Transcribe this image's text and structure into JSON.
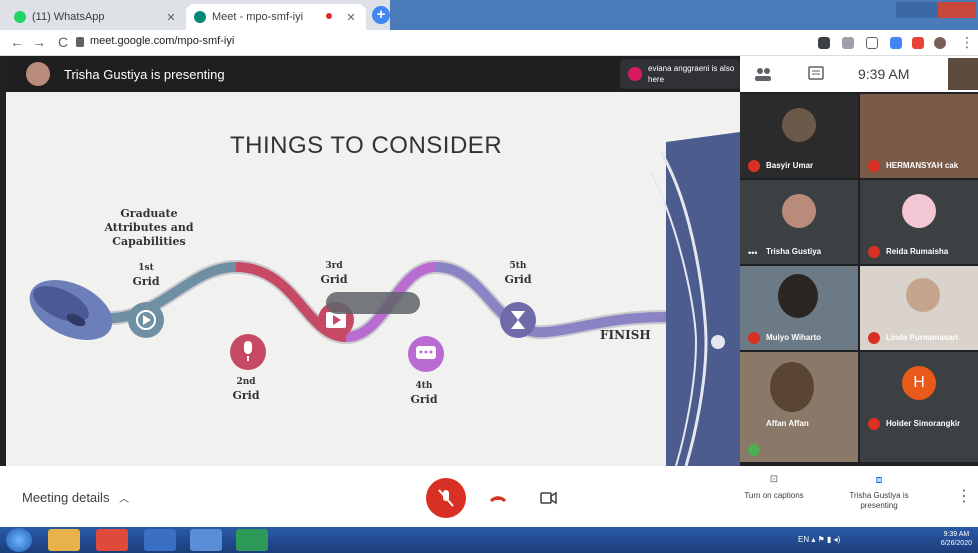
{
  "browser": {
    "tabs": [
      {
        "title": "(11) WhatsApp",
        "color": "#25d366"
      },
      {
        "title": "Meet - mpo-smf-iyi",
        "color": "#00897b"
      }
    ],
    "new_tab": "+",
    "url": "meet.google.com/mpo-smf-iyi",
    "back": "←",
    "forward": "→",
    "reload": "C"
  },
  "meet": {
    "presenter_text": "Trisha Gustiya is presenting",
    "also_here": "eviana anggraeni is also here",
    "clock": "9:39 AM",
    "slide": {
      "title": "THINGS TO CONSIDER",
      "graduate_label": [
        "Graduate",
        "Attributes and",
        "Capabilities"
      ],
      "grid_1": [
        "1st",
        "Grid"
      ],
      "grid_2": [
        "2nd",
        "Grid"
      ],
      "grid_3": [
        "3rd",
        "Grid"
      ],
      "grid_4": [
        "4th",
        "Grid"
      ],
      "grid_5": [
        "5th",
        "Grid"
      ],
      "finish": "FINISH"
    },
    "participants": [
      {
        "name": "Basyir Umar",
        "bg": "#2b2b2b"
      },
      {
        "name": "HERMANSYAH cak",
        "bg": "#7a5a48"
      },
      {
        "name": "Trisha Gustiya",
        "bg": "#3c4043"
      },
      {
        "name": "Reida Rumaisha",
        "bg": "#3c4043"
      },
      {
        "name": "Mulyo Wiharto",
        "bg": "#6b7a84"
      },
      {
        "name": "Linda Purnamasari",
        "bg": "#d9d3cc"
      },
      {
        "name": "Affan Affan",
        "bg": "#8a7868"
      },
      {
        "name": "Holder Simorangkir",
        "bg": "#3c4043"
      }
    ],
    "holder_initial": "H",
    "controls": {
      "meeting_details": "Meeting details",
      "captions": "Turn on captions",
      "presenting": "Trisha Gustiya is presenting"
    }
  },
  "taskbar": {
    "tray_time": "9:39 AM",
    "tray_date": "6/26/2020"
  }
}
